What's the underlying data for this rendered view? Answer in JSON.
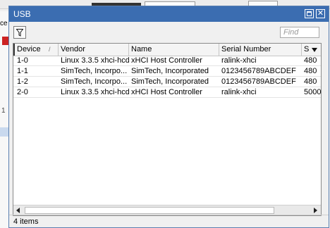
{
  "window": {
    "title": "USB",
    "close_glyph": "✕",
    "find_placeholder": "Find",
    "status": "4 items"
  },
  "background": {
    "fragment_text": "ce",
    "row_text": "1"
  },
  "table": {
    "columns": [
      "Device",
      "Vendor",
      "Name",
      "Serial Number",
      "S"
    ],
    "sorted_column": "Device",
    "rows": [
      {
        "device": "1-0",
        "vendor": "Linux 3.3.5 xhci-hcd",
        "name": "xHCI Host Controller",
        "serial": "ralink-xhci",
        "speed": "480"
      },
      {
        "device": "1-1",
        "vendor": "SimTech, Incorpo...",
        "name": "SimTech, Incorporated",
        "serial": "0123456789ABCDEF",
        "speed": "480"
      },
      {
        "device": "1-2",
        "vendor": "SimTech, Incorpo...",
        "name": "SimTech, Incorporated",
        "serial": "0123456789ABCDEF",
        "speed": "480"
      },
      {
        "device": "2-0",
        "vendor": "Linux 3.3.5 xhci-hcd",
        "name": "xHCI Host Controller",
        "serial": "ralink-xhci",
        "speed": "5000"
      }
    ]
  },
  "icons": {
    "filter": "filter-icon",
    "maximize": "maximize-icon",
    "close": "close-icon",
    "sort": "sort-ascending-icon",
    "column_menu": "column-menu-icon",
    "scroll_left": "arrow-left-icon",
    "scroll_right": "arrow-right-icon"
  },
  "colors": {
    "titlebar": "#3b6db1",
    "window_bg": "#f0f0f0",
    "grid_bg": "#ffffff"
  }
}
